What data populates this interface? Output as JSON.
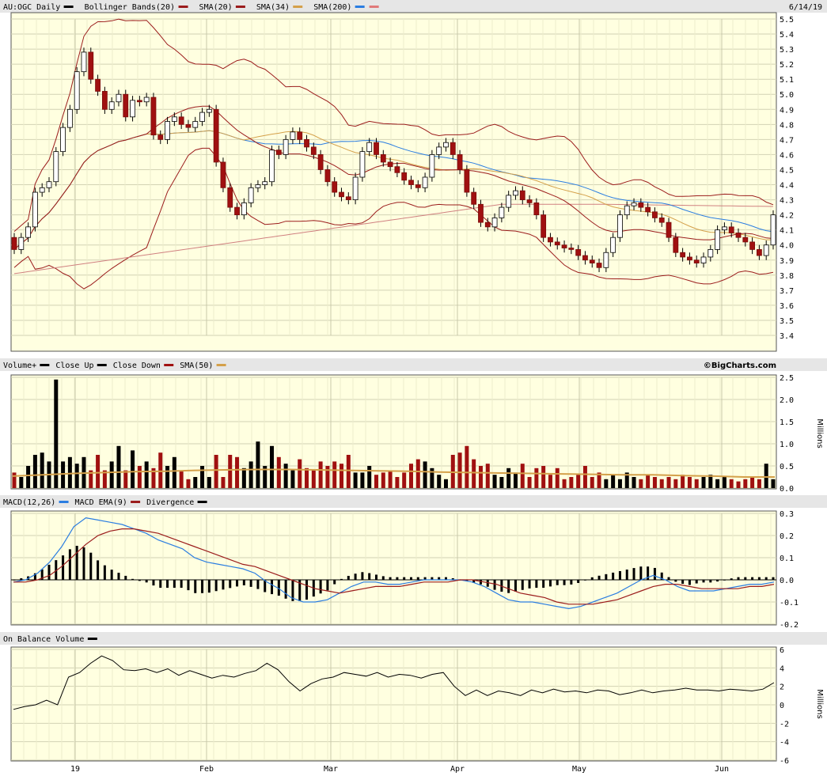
{
  "header": {
    "symbol": "AU:OGC Daily",
    "date": "6/14/19",
    "legend": [
      {
        "label": "Bollinger Bands(20)",
        "color": "#9b1c1c"
      },
      {
        "label": "SMA(20)",
        "color": "#9b1c1c"
      },
      {
        "label": "SMA(34)",
        "color": "#d4a04a"
      },
      {
        "label": "SMA(200)",
        "color": "#2a7de1"
      }
    ],
    "sma200_color": "#e07a7a"
  },
  "volume_panel": {
    "legend": [
      {
        "label": "Volume+",
        "color": "#000000"
      },
      {
        "label": "Close Up",
        "color": "#000000"
      },
      {
        "label": "Close Down",
        "color": "#a01010"
      },
      {
        "label": "SMA(50)",
        "color": "#d4a04a"
      }
    ],
    "credit": "©BigCharts.com",
    "unit_label": "Millions"
  },
  "macd_panel": {
    "legend": [
      {
        "label": "MACD(12,26)",
        "color": "#2a7de1"
      },
      {
        "label": "MACD EMA(9)",
        "color": "#9b1c1c"
      },
      {
        "label": "Divergence",
        "color": "#000000"
      }
    ]
  },
  "obv_panel": {
    "legend": [
      {
        "label": "On Balance Volume",
        "color": "#000000"
      }
    ],
    "unit_label": "Millions"
  },
  "x_axis": {
    "labels": [
      "19",
      "Feb",
      "Mar",
      "Apr",
      "May",
      "Jun"
    ]
  },
  "chart_data": [
    {
      "type": "candlestick",
      "title": "AU:OGC Daily",
      "ylim": [
        3.4,
        5.5
      ],
      "y_ticks": [
        "5.5",
        "5.4",
        "5.3",
        "5.2",
        "5.1",
        "5.0",
        "4.9",
        "4.8",
        "4.7",
        "4.6",
        "4.5",
        "4.4",
        "4.3",
        "4.2",
        "4.1",
        "4.0",
        "3.9",
        "3.8",
        "3.7",
        "3.6",
        "3.5",
        "3.4"
      ],
      "closes": [
        3.97,
        4.05,
        4.12,
        4.35,
        4.38,
        4.42,
        4.62,
        4.78,
        4.9,
        5.15,
        5.28,
        5.1,
        5.02,
        4.9,
        4.95,
        5.0,
        4.85,
        4.96,
        4.95,
        4.98,
        4.73,
        4.7,
        4.82,
        4.85,
        4.8,
        4.78,
        4.82,
        4.88,
        4.9,
        4.55,
        4.38,
        4.25,
        4.2,
        4.28,
        4.38,
        4.4,
        4.42,
        4.63,
        4.6,
        4.7,
        4.75,
        4.7,
        4.65,
        4.6,
        4.5,
        4.42,
        4.35,
        4.32,
        4.3,
        4.45,
        4.62,
        4.68,
        4.6,
        4.55,
        4.52,
        4.48,
        4.43,
        4.4,
        4.38,
        4.45,
        4.6,
        4.65,
        4.68,
        4.6,
        4.5,
        4.35,
        4.27,
        4.15,
        4.12,
        4.18,
        4.25,
        4.33,
        4.36,
        4.3,
        4.28,
        4.2,
        4.05,
        4.02,
        4.0,
        3.98,
        3.97,
        3.93,
        3.9,
        3.88,
        3.85,
        3.95,
        4.05,
        4.2,
        4.26,
        4.28,
        4.25,
        4.22,
        4.18,
        4.15,
        4.05,
        3.95,
        3.92,
        3.9,
        3.88,
        3.92,
        3.97,
        4.1,
        4.12,
        4.08,
        4.05,
        4.02,
        3.97,
        3.93,
        4.0,
        4.2
      ],
      "series": [
        {
          "name": "Bollinger Bands(20)",
          "color": "#9b1c1c"
        },
        {
          "name": "SMA(20)",
          "color": "#9b1c1c"
        },
        {
          "name": "SMA(34)",
          "color": "#d4a04a"
        },
        {
          "name": "SMA(200)",
          "color": "#2a7de1"
        }
      ]
    },
    {
      "type": "bar",
      "title": "Volume+",
      "ylim": [
        0,
        2.5
      ],
      "y_ticks": [
        "2.5",
        "2.0",
        "1.5",
        "1.0",
        "0.5",
        "0.0"
      ],
      "ylabel": "Millions",
      "values": [
        0.35,
        0.25,
        0.5,
        0.75,
        0.8,
        0.6,
        2.45,
        0.6,
        0.7,
        0.55,
        0.7,
        0.4,
        0.75,
        0.4,
        0.6,
        0.95,
        0.4,
        0.85,
        0.5,
        0.6,
        0.45,
        0.8,
        0.5,
        0.7,
        0.4,
        0.2,
        0.25,
        0.5,
        0.25,
        0.75,
        0.25,
        0.75,
        0.7,
        0.45,
        0.6,
        1.05,
        0.5,
        0.95,
        0.7,
        0.55,
        0.4,
        0.65,
        0.45,
        0.4,
        0.6,
        0.5,
        0.6,
        0.55,
        0.75,
        0.35,
        0.35,
        0.5,
        0.3,
        0.35,
        0.4,
        0.25,
        0.35,
        0.55,
        0.65,
        0.6,
        0.45,
        0.3,
        0.2,
        0.75,
        0.8,
        0.95,
        0.65,
        0.5,
        0.55,
        0.3,
        0.25,
        0.45,
        0.35,
        0.55,
        0.25,
        0.45,
        0.5,
        0.3,
        0.45,
        0.2,
        0.25,
        0.3,
        0.5,
        0.25,
        0.35,
        0.2,
        0.3,
        0.2,
        0.35,
        0.25,
        0.2,
        0.3,
        0.25,
        0.2,
        0.25,
        0.2,
        0.3,
        0.25,
        0.2,
        0.25,
        0.3,
        0.2,
        0.25,
        0.2,
        0.15,
        0.2,
        0.25,
        0.2,
        0.55,
        0.2
      ],
      "sma50": [
        0.27,
        0.3,
        0.33,
        0.35,
        0.37,
        0.38,
        0.4,
        0.41,
        0.42,
        0.42,
        0.41,
        0.4,
        0.39,
        0.38,
        0.36,
        0.35,
        0.34,
        0.33,
        0.32,
        0.31,
        0.3,
        0.3,
        0.28,
        0.27,
        0.25,
        0.25
      ]
    },
    {
      "type": "line",
      "title": "MACD(12,26)",
      "ylim": [
        -0.2,
        0.3
      ],
      "y_ticks": [
        "0.3",
        "0.2",
        "0.1",
        "0.0",
        "-0.1",
        "-0.2"
      ],
      "series": [
        {
          "name": "MACD(12,26)",
          "color": "#2a7de1"
        },
        {
          "name": "MACD EMA(9)",
          "color": "#9b1c1c"
        },
        {
          "name": "Divergence",
          "color": "#000000"
        }
      ],
      "macd": [
        -0.01,
        0.0,
        0.03,
        0.08,
        0.15,
        0.24,
        0.28,
        0.27,
        0.26,
        0.25,
        0.23,
        0.21,
        0.18,
        0.16,
        0.14,
        0.1,
        0.08,
        0.07,
        0.06,
        0.05,
        0.03,
        -0.01,
        -0.04,
        -0.08,
        -0.1,
        -0.1,
        -0.09,
        -0.06,
        -0.03,
        -0.01,
        -0.01,
        -0.02,
        -0.02,
        -0.01,
        0.0,
        0.0,
        0.0,
        0.0,
        -0.01,
        -0.03,
        -0.06,
        -0.09,
        -0.1,
        -0.1,
        -0.11,
        -0.12,
        -0.13,
        -0.12,
        -0.1,
        -0.08,
        -0.06,
        -0.03,
        0.0,
        0.02,
        0.0,
        -0.03,
        -0.05,
        -0.05,
        -0.05,
        -0.04,
        -0.03,
        -0.02,
        -0.02,
        -0.01
      ],
      "signal": [
        -0.01,
        -0.01,
        0.0,
        0.02,
        0.06,
        0.11,
        0.16,
        0.2,
        0.22,
        0.23,
        0.23,
        0.22,
        0.21,
        0.19,
        0.17,
        0.15,
        0.13,
        0.11,
        0.09,
        0.07,
        0.06,
        0.04,
        0.02,
        0.0,
        -0.02,
        -0.04,
        -0.05,
        -0.06,
        -0.05,
        -0.04,
        -0.03,
        -0.03,
        -0.03,
        -0.02,
        -0.01,
        -0.01,
        -0.01,
        0.0,
        0.0,
        -0.01,
        -0.02,
        -0.04,
        -0.06,
        -0.07,
        -0.08,
        -0.1,
        -0.11,
        -0.11,
        -0.11,
        -0.1,
        -0.09,
        -0.07,
        -0.05,
        -0.03,
        -0.02,
        -0.02,
        -0.03,
        -0.04,
        -0.04,
        -0.04,
        -0.04,
        -0.03,
        -0.03,
        -0.02
      ]
    },
    {
      "type": "line",
      "title": "On Balance Volume",
      "ylim": [
        -6,
        6
      ],
      "y_ticks": [
        "6",
        "4",
        "2",
        "0",
        "-2",
        "-4",
        "-6"
      ],
      "ylabel": "Millions",
      "values": [
        -0.5,
        -0.2,
        0.0,
        0.5,
        0.0,
        3.0,
        3.5,
        4.5,
        5.3,
        4.8,
        3.8,
        3.7,
        3.9,
        3.5,
        3.9,
        3.2,
        3.7,
        3.3,
        2.9,
        3.2,
        3.0,
        3.4,
        3.7,
        4.5,
        3.8,
        2.5,
        1.5,
        2.3,
        2.8,
        3.0,
        3.5,
        3.3,
        3.1,
        3.5,
        3.0,
        3.3,
        3.2,
        2.9,
        3.3,
        3.5,
        2.0,
        1.0,
        1.6,
        1.0,
        1.5,
        1.3,
        1.0,
        1.6,
        1.3,
        1.7,
        1.4,
        1.5,
        1.3,
        1.6,
        1.5,
        1.1,
        1.3,
        1.6,
        1.3,
        1.5,
        1.6,
        1.8,
        1.6,
        1.6,
        1.5,
        1.7,
        1.6,
        1.5,
        1.7,
        2.4
      ]
    }
  ]
}
